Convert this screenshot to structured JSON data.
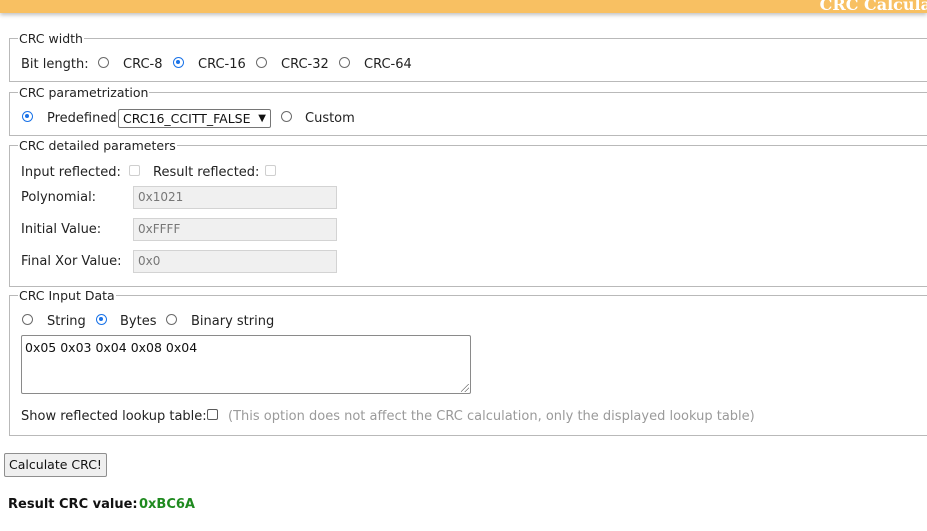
{
  "header": {
    "title": "CRC Calcula"
  },
  "crc_width": {
    "legend": "CRC width",
    "label": "Bit length:",
    "options": [
      "CRC-8",
      "CRC-16",
      "CRC-32",
      "CRC-64"
    ],
    "selected": "CRC-16"
  },
  "parametrization": {
    "legend": "CRC parametrization",
    "predefined_label": "Predefined",
    "predefined_value": "CRC16_CCITT_FALSE",
    "custom_label": "Custom",
    "selected": "Predefined"
  },
  "detailed": {
    "legend": "CRC detailed parameters",
    "input_reflected_label": "Input reflected:",
    "result_reflected_label": "Result reflected:",
    "polynomial_label": "Polynomial:",
    "polynomial_value": "0x1021",
    "initial_label": "Initial Value:",
    "initial_value": "0xFFFF",
    "final_xor_label": "Final Xor Value:",
    "final_xor_value": "0x0"
  },
  "input_data": {
    "legend": "CRC Input Data",
    "modes": [
      "String",
      "Bytes",
      "Binary string"
    ],
    "selected_mode": "Bytes",
    "value": "0x05 0x03 0x04 0x08 0x04",
    "lookup_label": "Show reflected lookup table:",
    "lookup_hint": "(This option does not affect the CRC calculation, only the displayed lookup table)"
  },
  "actions": {
    "calculate_label": "Calculate CRC!"
  },
  "result": {
    "label": "Result CRC value:",
    "value": "0xBC6A"
  },
  "colors": {
    "header": "#f8c062",
    "accent": "#1a73e8",
    "result": "#1f8a1f"
  }
}
